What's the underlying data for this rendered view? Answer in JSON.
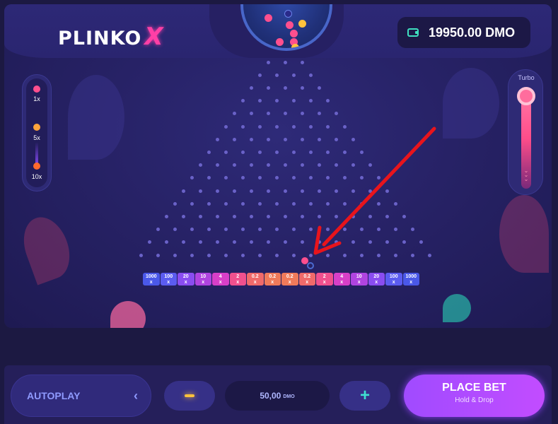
{
  "app": {
    "logo_text": "PLINKO",
    "logo_x": "X"
  },
  "header": {
    "balance": "19950.00 DMO"
  },
  "risk_selector": {
    "levels": [
      "1x",
      "5x",
      "10x"
    ]
  },
  "turbo": {
    "label": "Turbo"
  },
  "board": {
    "multipliers": [
      "1000 x",
      "100 x",
      "20 x",
      "10 x",
      "4 x",
      "2 x",
      "0.2 x",
      "0.2 x",
      "0.2 x",
      "0.2 x",
      "2 x",
      "4 x",
      "10 x",
      "20 x",
      "100 x",
      "1000 x"
    ],
    "multiplier_colors": [
      "#4a58e8",
      "#5b5cf0",
      "#8a4df0",
      "#b044e0",
      "#d83fc8",
      "#f0508e",
      "#f06a6a",
      "#f07a5a",
      "#f07a5a",
      "#f06a6a",
      "#f0508e",
      "#d83fc8",
      "#b044e0",
      "#8a4df0",
      "#5b5cf0",
      "#4a58e8"
    ]
  },
  "controls": {
    "autoplay_label": "AUTOPLAY",
    "bet_value": "50,00",
    "bet_unit": "DMO",
    "place_bet_label": "PLACE BET",
    "place_bet_sub": "Hold & Drop"
  },
  "colors": {
    "accent_pink": "#ff3fa6",
    "accent_purple": "#b44cff",
    "accent_teal": "#3fe0c0",
    "arrow_red": "#e8141c"
  }
}
